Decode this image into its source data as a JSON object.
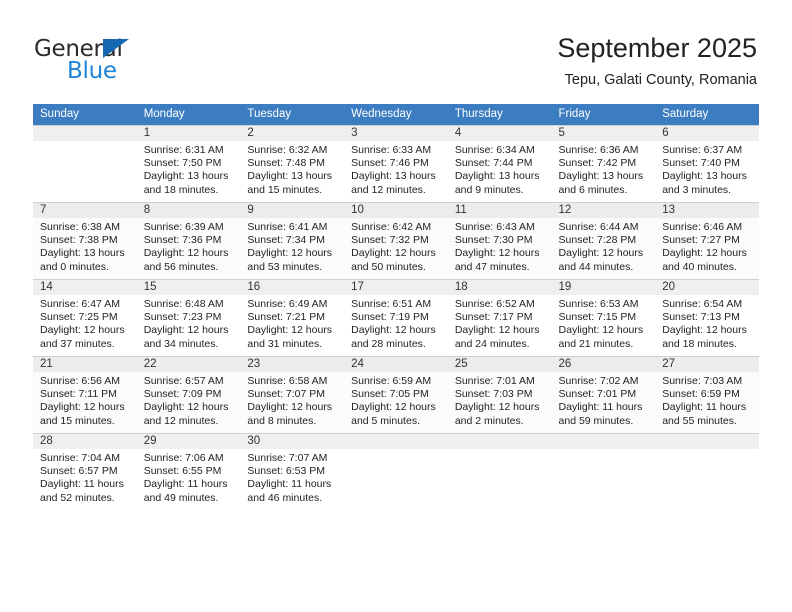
{
  "brand": {
    "name_part1": "General",
    "name_part2": "Blue",
    "accent_color": "#1f84d6",
    "triangle_color": "#1667b2"
  },
  "header": {
    "title": "September 2025",
    "subtitle": "Tepu, Galati County, Romania"
  },
  "calendar": {
    "header_bg": "#3b7dc0",
    "weekday_headers": [
      "Sunday",
      "Monday",
      "Tuesday",
      "Wednesday",
      "Thursday",
      "Friday",
      "Saturday"
    ],
    "weeks": [
      [
        {
          "day": "",
          "sunrise": "",
          "sunset": "",
          "daylight_line1": "",
          "daylight_line2": ""
        },
        {
          "day": "1",
          "sunrise": "Sunrise: 6:31 AM",
          "sunset": "Sunset: 7:50 PM",
          "daylight_line1": "Daylight: 13 hours",
          "daylight_line2": "and 18 minutes."
        },
        {
          "day": "2",
          "sunrise": "Sunrise: 6:32 AM",
          "sunset": "Sunset: 7:48 PM",
          "daylight_line1": "Daylight: 13 hours",
          "daylight_line2": "and 15 minutes."
        },
        {
          "day": "3",
          "sunrise": "Sunrise: 6:33 AM",
          "sunset": "Sunset: 7:46 PM",
          "daylight_line1": "Daylight: 13 hours",
          "daylight_line2": "and 12 minutes."
        },
        {
          "day": "4",
          "sunrise": "Sunrise: 6:34 AM",
          "sunset": "Sunset: 7:44 PM",
          "daylight_line1": "Daylight: 13 hours",
          "daylight_line2": "and 9 minutes."
        },
        {
          "day": "5",
          "sunrise": "Sunrise: 6:36 AM",
          "sunset": "Sunset: 7:42 PM",
          "daylight_line1": "Daylight: 13 hours",
          "daylight_line2": "and 6 minutes."
        },
        {
          "day": "6",
          "sunrise": "Sunrise: 6:37 AM",
          "sunset": "Sunset: 7:40 PM",
          "daylight_line1": "Daylight: 13 hours",
          "daylight_line2": "and 3 minutes."
        }
      ],
      [
        {
          "day": "7",
          "sunrise": "Sunrise: 6:38 AM",
          "sunset": "Sunset: 7:38 PM",
          "daylight_line1": "Daylight: 13 hours",
          "daylight_line2": "and 0 minutes."
        },
        {
          "day": "8",
          "sunrise": "Sunrise: 6:39 AM",
          "sunset": "Sunset: 7:36 PM",
          "daylight_line1": "Daylight: 12 hours",
          "daylight_line2": "and 56 minutes."
        },
        {
          "day": "9",
          "sunrise": "Sunrise: 6:41 AM",
          "sunset": "Sunset: 7:34 PM",
          "daylight_line1": "Daylight: 12 hours",
          "daylight_line2": "and 53 minutes."
        },
        {
          "day": "10",
          "sunrise": "Sunrise: 6:42 AM",
          "sunset": "Sunset: 7:32 PM",
          "daylight_line1": "Daylight: 12 hours",
          "daylight_line2": "and 50 minutes."
        },
        {
          "day": "11",
          "sunrise": "Sunrise: 6:43 AM",
          "sunset": "Sunset: 7:30 PM",
          "daylight_line1": "Daylight: 12 hours",
          "daylight_line2": "and 47 minutes."
        },
        {
          "day": "12",
          "sunrise": "Sunrise: 6:44 AM",
          "sunset": "Sunset: 7:28 PM",
          "daylight_line1": "Daylight: 12 hours",
          "daylight_line2": "and 44 minutes."
        },
        {
          "day": "13",
          "sunrise": "Sunrise: 6:46 AM",
          "sunset": "Sunset: 7:27 PM",
          "daylight_line1": "Daylight: 12 hours",
          "daylight_line2": "and 40 minutes."
        }
      ],
      [
        {
          "day": "14",
          "sunrise": "Sunrise: 6:47 AM",
          "sunset": "Sunset: 7:25 PM",
          "daylight_line1": "Daylight: 12 hours",
          "daylight_line2": "and 37 minutes."
        },
        {
          "day": "15",
          "sunrise": "Sunrise: 6:48 AM",
          "sunset": "Sunset: 7:23 PM",
          "daylight_line1": "Daylight: 12 hours",
          "daylight_line2": "and 34 minutes."
        },
        {
          "day": "16",
          "sunrise": "Sunrise: 6:49 AM",
          "sunset": "Sunset: 7:21 PM",
          "daylight_line1": "Daylight: 12 hours",
          "daylight_line2": "and 31 minutes."
        },
        {
          "day": "17",
          "sunrise": "Sunrise: 6:51 AM",
          "sunset": "Sunset: 7:19 PM",
          "daylight_line1": "Daylight: 12 hours",
          "daylight_line2": "and 28 minutes."
        },
        {
          "day": "18",
          "sunrise": "Sunrise: 6:52 AM",
          "sunset": "Sunset: 7:17 PM",
          "daylight_line1": "Daylight: 12 hours",
          "daylight_line2": "and 24 minutes."
        },
        {
          "day": "19",
          "sunrise": "Sunrise: 6:53 AM",
          "sunset": "Sunset: 7:15 PM",
          "daylight_line1": "Daylight: 12 hours",
          "daylight_line2": "and 21 minutes."
        },
        {
          "day": "20",
          "sunrise": "Sunrise: 6:54 AM",
          "sunset": "Sunset: 7:13 PM",
          "daylight_line1": "Daylight: 12 hours",
          "daylight_line2": "and 18 minutes."
        }
      ],
      [
        {
          "day": "21",
          "sunrise": "Sunrise: 6:56 AM",
          "sunset": "Sunset: 7:11 PM",
          "daylight_line1": "Daylight: 12 hours",
          "daylight_line2": "and 15 minutes."
        },
        {
          "day": "22",
          "sunrise": "Sunrise: 6:57 AM",
          "sunset": "Sunset: 7:09 PM",
          "daylight_line1": "Daylight: 12 hours",
          "daylight_line2": "and 12 minutes."
        },
        {
          "day": "23",
          "sunrise": "Sunrise: 6:58 AM",
          "sunset": "Sunset: 7:07 PM",
          "daylight_line1": "Daylight: 12 hours",
          "daylight_line2": "and 8 minutes."
        },
        {
          "day": "24",
          "sunrise": "Sunrise: 6:59 AM",
          "sunset": "Sunset: 7:05 PM",
          "daylight_line1": "Daylight: 12 hours",
          "daylight_line2": "and 5 minutes."
        },
        {
          "day": "25",
          "sunrise": "Sunrise: 7:01 AM",
          "sunset": "Sunset: 7:03 PM",
          "daylight_line1": "Daylight: 12 hours",
          "daylight_line2": "and 2 minutes."
        },
        {
          "day": "26",
          "sunrise": "Sunrise: 7:02 AM",
          "sunset": "Sunset: 7:01 PM",
          "daylight_line1": "Daylight: 11 hours",
          "daylight_line2": "and 59 minutes."
        },
        {
          "day": "27",
          "sunrise": "Sunrise: 7:03 AM",
          "sunset": "Sunset: 6:59 PM",
          "daylight_line1": "Daylight: 11 hours",
          "daylight_line2": "and 55 minutes."
        }
      ],
      [
        {
          "day": "28",
          "sunrise": "Sunrise: 7:04 AM",
          "sunset": "Sunset: 6:57 PM",
          "daylight_line1": "Daylight: 11 hours",
          "daylight_line2": "and 52 minutes."
        },
        {
          "day": "29",
          "sunrise": "Sunrise: 7:06 AM",
          "sunset": "Sunset: 6:55 PM",
          "daylight_line1": "Daylight: 11 hours",
          "daylight_line2": "and 49 minutes."
        },
        {
          "day": "30",
          "sunrise": "Sunrise: 7:07 AM",
          "sunset": "Sunset: 6:53 PM",
          "daylight_line1": "Daylight: 11 hours",
          "daylight_line2": "and 46 minutes."
        },
        {
          "day": "",
          "sunrise": "",
          "sunset": "",
          "daylight_line1": "",
          "daylight_line2": ""
        },
        {
          "day": "",
          "sunrise": "",
          "sunset": "",
          "daylight_line1": "",
          "daylight_line2": ""
        },
        {
          "day": "",
          "sunrise": "",
          "sunset": "",
          "daylight_line1": "",
          "daylight_line2": ""
        },
        {
          "day": "",
          "sunrise": "",
          "sunset": "",
          "daylight_line1": "",
          "daylight_line2": ""
        }
      ]
    ]
  }
}
